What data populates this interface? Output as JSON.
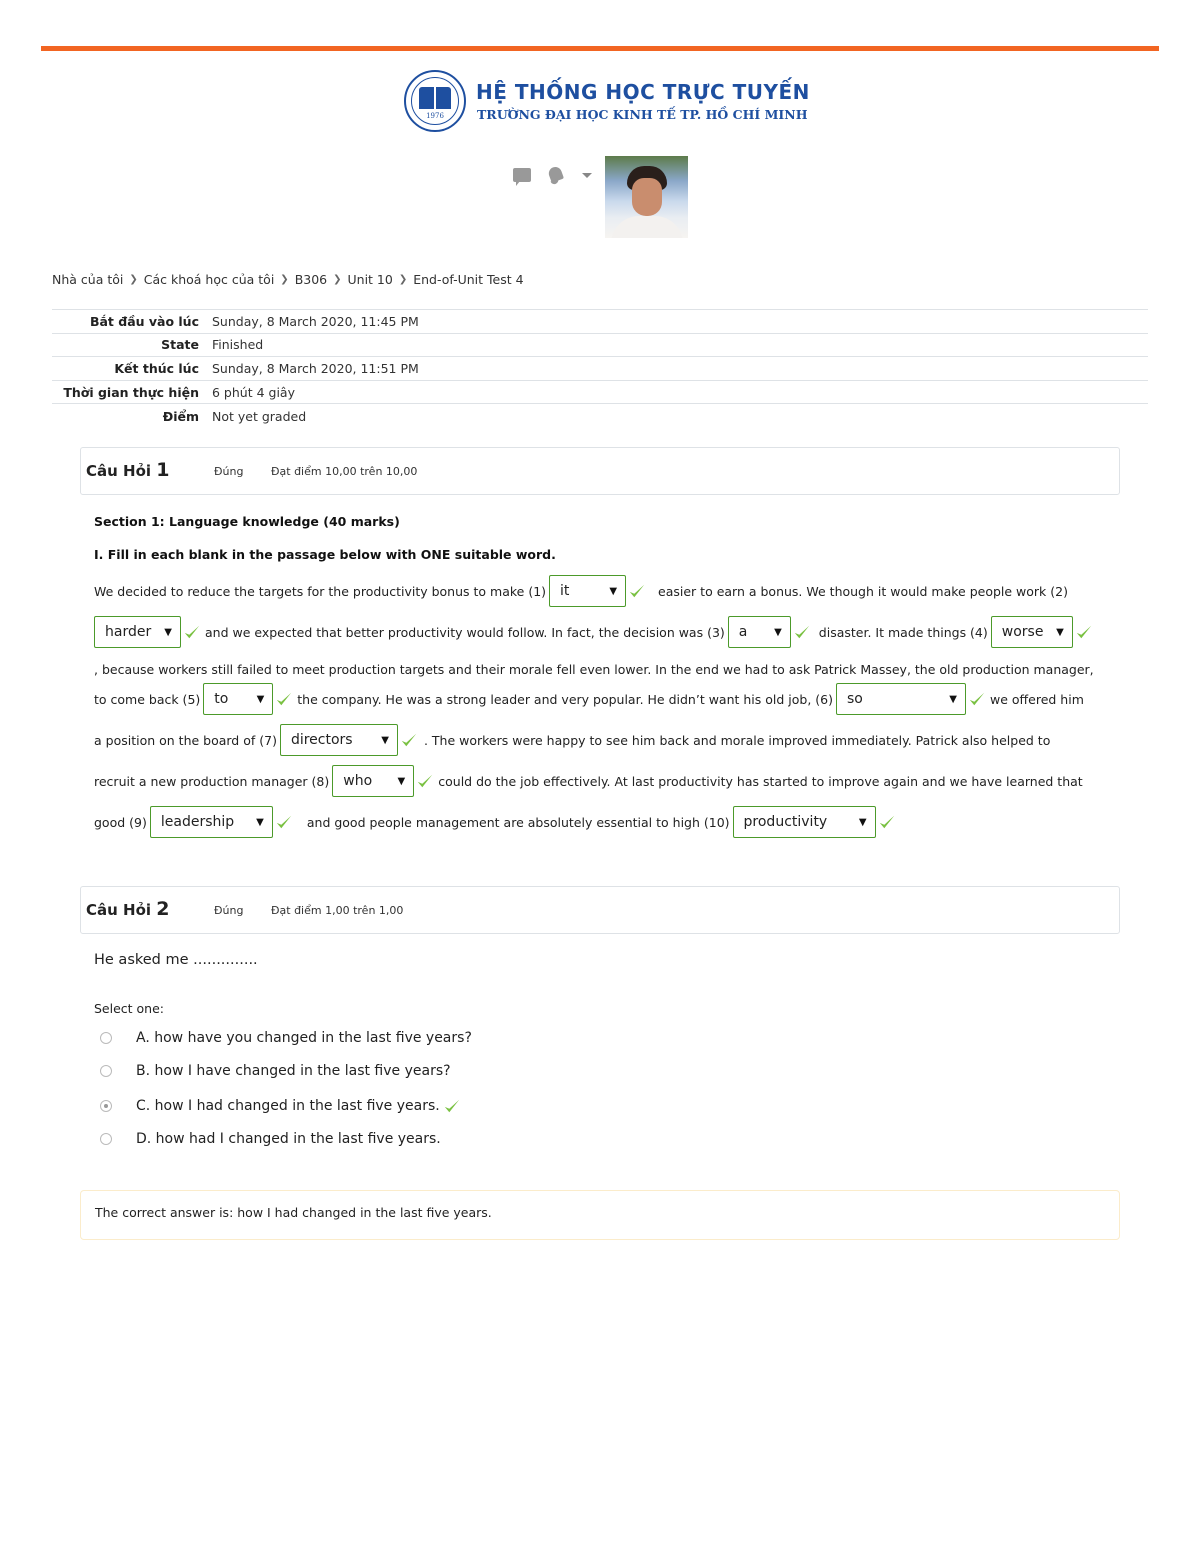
{
  "branding": {
    "title": "HỆ THỐNG HỌC TRỰC TUYẾN",
    "subtitle": "TRƯỜNG ĐẠI HỌC KINH TẾ TP. HỒ CHÍ MINH",
    "seal_year": "1976",
    "accent_color": "#f26522",
    "brand_color": "#1e4fa0"
  },
  "usernav": {
    "icons": [
      "message-icon",
      "bell-icon",
      "caret-down-icon"
    ]
  },
  "breadcrumb": [
    {
      "label": "Nhà của tôi"
    },
    {
      "label": "Các khoá học của tôi"
    },
    {
      "label": "B306"
    },
    {
      "label": "Unit 10"
    },
    {
      "label": "End-of-Unit Test 4"
    }
  ],
  "summary": [
    {
      "label": "Bắt đầu vào lúc",
      "value": "Sunday, 8 March 2020, 11:45 PM"
    },
    {
      "label": "State",
      "value": "Finished"
    },
    {
      "label": "Kết thúc lúc",
      "value": "Sunday, 8 March 2020, 11:51 PM"
    },
    {
      "label": "Thời gian thực hiện",
      "value": "6 phút 4 giây"
    },
    {
      "label": "Điểm",
      "value": "Not yet graded"
    }
  ],
  "questions": [
    {
      "title_prefix": "Câu Hỏi",
      "number": "1",
      "state": "Đúng",
      "grade": "Đạt điểm 10,00 trên 10,00",
      "section_title": "Section 1: Language knowledge (40 marks)",
      "instruction": "I. Fill in each blank in the passage below with ONE suitable word.",
      "passage": {
        "t1": "We decided to reduce the targets for the productivity bonus to make (1)",
        "t2": "easier to earn a bonus. We though it would make people work (2)",
        "t3": "and we expected that better productivity would follow. In fact, the decision was (3)",
        "t4": "disaster. It made things (4)",
        "t5": ", because workers still failed to meet production targets and their morale fell even lower. In the end we had to ask Patrick Massey, the old production manager,",
        "t6": "to come back (5)",
        "t7": "the company. He was a strong leader and very popular. He didn’t want his old job, (6)",
        "t8": "we offered him",
        "t9": "a position on the board of (7)",
        "t10": ". The workers were happy to see him back and morale improved immediately. Patrick also helped to",
        "t11": "recruit a new production manager (8)",
        "t12": "could do the job effectively. At last productivity has started to improve again and we have learned that",
        "t13": "good (9)",
        "t14": "and good people management are absolutely essential to high (10)"
      },
      "blanks": [
        {
          "value": "it",
          "correct": true
        },
        {
          "value": "harder",
          "correct": true
        },
        {
          "value": "a",
          "correct": true
        },
        {
          "value": "worse",
          "correct": true
        },
        {
          "value": "to",
          "correct": true
        },
        {
          "value": "so",
          "correct": true
        },
        {
          "value": "directors",
          "correct": true
        },
        {
          "value": "who",
          "correct": true
        },
        {
          "value": "leadership",
          "correct": true
        },
        {
          "value": "productivity",
          "correct": true
        }
      ],
      "dropdown_arrow": "▼"
    },
    {
      "title_prefix": "Câu Hỏi",
      "number": "2",
      "state": "Đúng",
      "grade": "Đạt điểm 1,00 trên 1,00",
      "question_text": "He asked me ..............",
      "prompt": "Select one:",
      "options": [
        {
          "label": "A. how have you changed in the last five years?",
          "selected": false
        },
        {
          "label": "B. how I have changed in the last five years?",
          "selected": false
        },
        {
          "label": "C. how I had changed in the last five years.",
          "selected": true,
          "correct": true
        },
        {
          "label": "D. how had I changed in the last five years.",
          "selected": false
        }
      ],
      "feedback": "The correct answer is: how I had changed in the last five years."
    }
  ],
  "colors": {
    "correct_check": "#7ac142",
    "select_border": "#4c9a2a",
    "feedback_border": "#fbeccb"
  }
}
